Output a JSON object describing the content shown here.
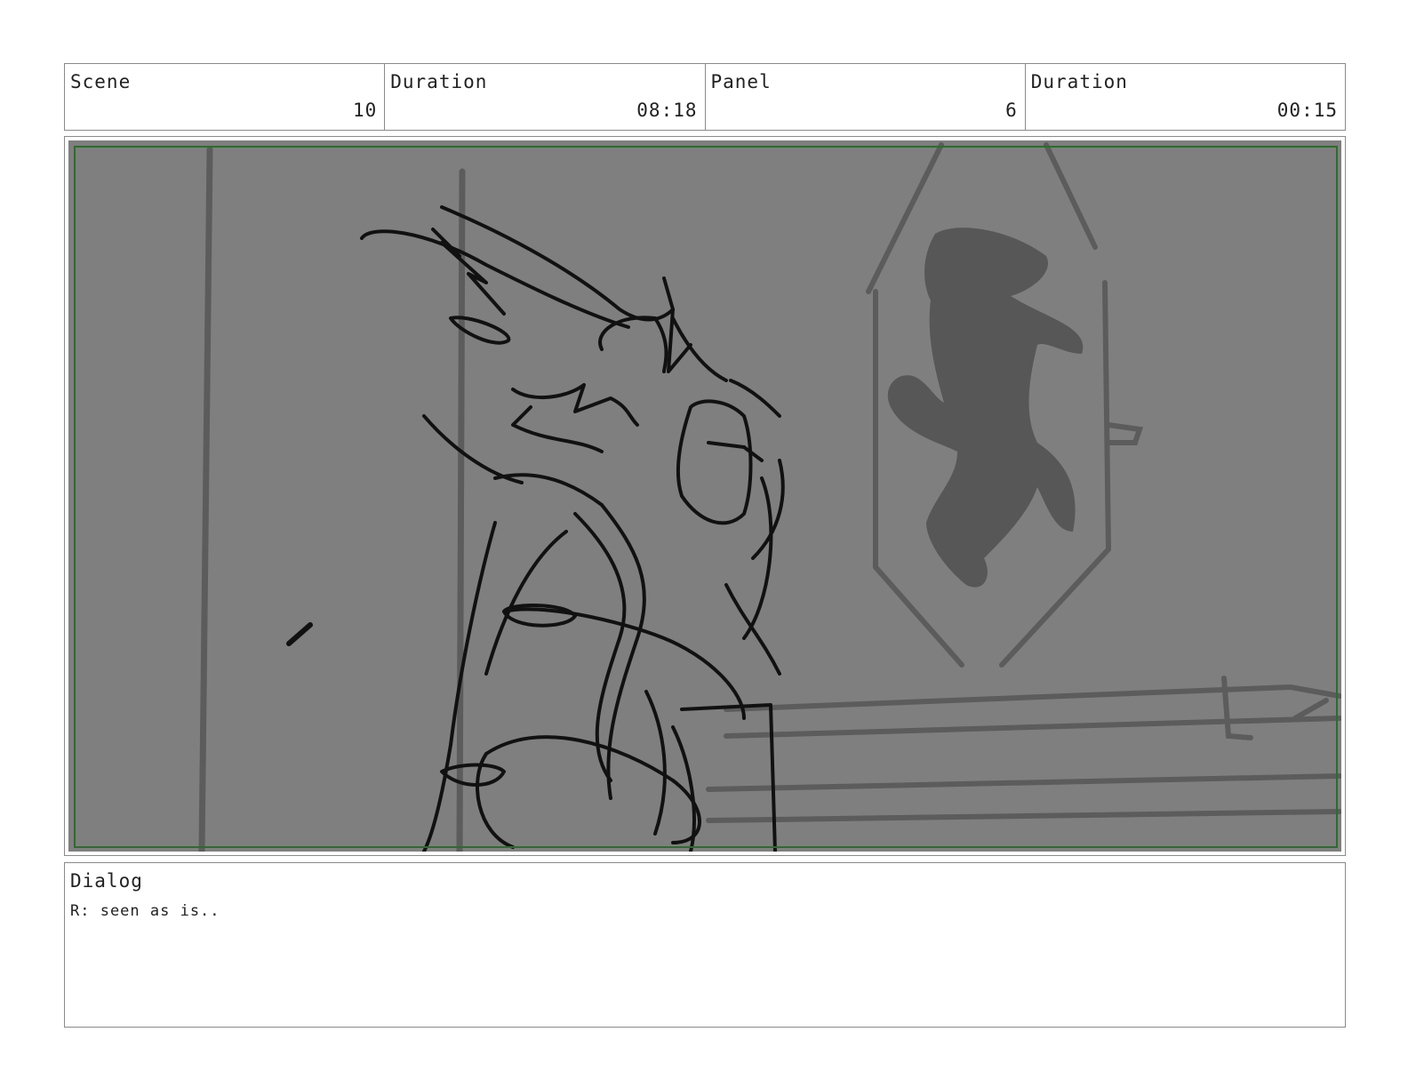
{
  "header": {
    "scene": {
      "label": "Scene",
      "value": "10"
    },
    "scene_duration": {
      "label": "Duration",
      "value": "08:18"
    },
    "panel": {
      "label": "Panel",
      "value": "6"
    },
    "panel_duration": {
      "label": "Duration",
      "value": "00:15"
    }
  },
  "dialog": {
    "label": "Dialog",
    "text": "R: seen as is.."
  },
  "colors": {
    "panel_background": "#7f7f7f",
    "safe_frame": "#2f6b2f",
    "sketch_line": "#111111",
    "background_line": "#5a5a5a"
  },
  "sketch": {
    "description_icon": "storyboard-sketch-icon"
  }
}
